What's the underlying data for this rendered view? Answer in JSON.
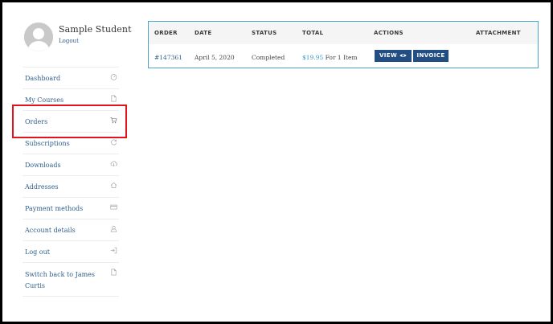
{
  "user": {
    "name": "Sample Student",
    "logout_label": "Logout"
  },
  "nav": {
    "items": [
      {
        "label": "Dashboard",
        "icon": "gauge-icon"
      },
      {
        "label": "My Courses",
        "icon": "document-icon"
      },
      {
        "label": "Orders",
        "icon": "cart-icon"
      },
      {
        "label": "Subscriptions",
        "icon": "refresh-icon"
      },
      {
        "label": "Downloads",
        "icon": "cloud-download-icon"
      },
      {
        "label": "Addresses",
        "icon": "home-icon"
      },
      {
        "label": "Payment methods",
        "icon": "credit-card-icon"
      },
      {
        "label": "Account details",
        "icon": "user-icon"
      },
      {
        "label": "Log out",
        "icon": "sign-out-icon"
      },
      {
        "label": "Switch back to James Curtis",
        "icon": "document-icon"
      }
    ]
  },
  "orders_table": {
    "headers": {
      "order": "ORDER",
      "date": "DATE",
      "status": "STATUS",
      "total": "TOTAL",
      "actions": "ACTIONS",
      "attachment": "ATTACHMENT"
    },
    "rows": [
      {
        "order": "#147361",
        "date": "April 5, 2020",
        "status": "Completed",
        "total_price": "$19.95",
        "total_items": "For 1 Item",
        "view_label": "VIEW",
        "invoice_label": "INVOICE"
      }
    ]
  },
  "colors": {
    "link": "#2e5d8b",
    "button": "#234e84",
    "table_border": "#4aa3c9",
    "highlight": "#e0141a"
  }
}
